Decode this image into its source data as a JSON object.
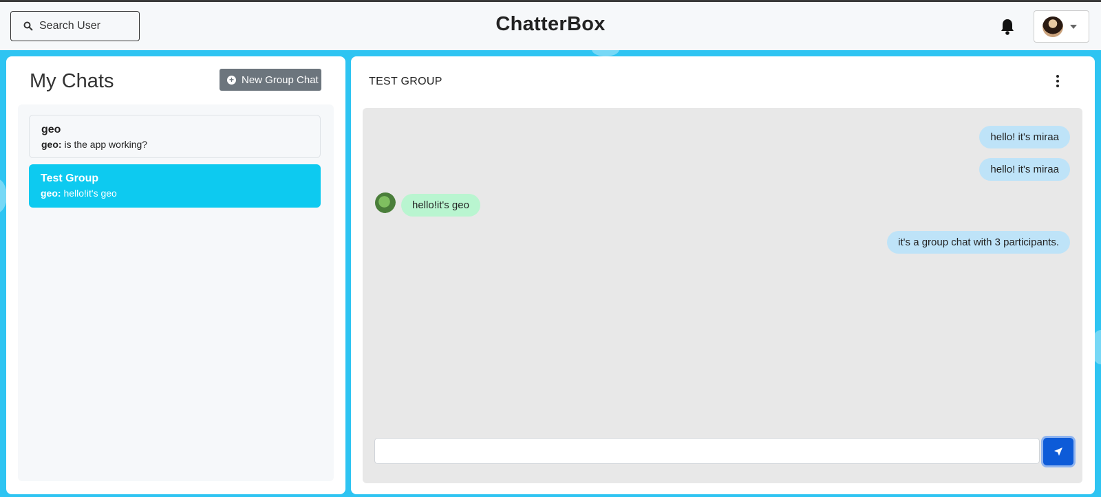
{
  "topbar": {
    "search_label": "Search User",
    "app_title": "ChatterBox"
  },
  "sidebar": {
    "title": "My Chats",
    "new_group_label": "New Group Chat",
    "chats": [
      {
        "name": "geo",
        "sender": "geo:",
        "last_message": "is the app working?"
      },
      {
        "name": "Test Group",
        "sender": "geo:",
        "last_message": "hello!it's geo"
      }
    ]
  },
  "chat": {
    "title": "TEST GROUP",
    "messages": [
      {
        "text": "hello! it's miraa"
      },
      {
        "text": "hello! it's miraa"
      },
      {
        "text": "hello!it's geo"
      },
      {
        "text": "it's a group chat with 3 participants."
      }
    ],
    "input_value": ""
  },
  "colors": {
    "background": "#2ec4f2",
    "active_chat": "#0dcaf0",
    "send_button": "#0d5bd8",
    "my_bubble": "#bee3f8",
    "their_bubble": "#b9f5d0"
  }
}
